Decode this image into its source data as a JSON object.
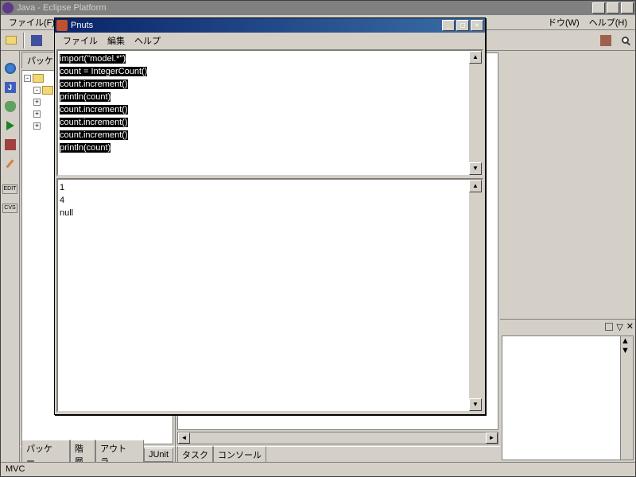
{
  "eclipse": {
    "title": "Java - Eclipse Platform",
    "menus": {
      "file": "ファイル(F)",
      "window_partial": "ドウ(W)",
      "help": "ヘルプ(H)"
    },
    "left_tab": "パッケ",
    "bottom_tabs": {
      "package": "パッケー...",
      "hierarchy": "階層",
      "outline": "アウトラ...",
      "junit": "JUnit",
      "tasks": "タスク",
      "console": "コンソール"
    },
    "status": "MVC"
  },
  "pnuts": {
    "title": "Pnuts",
    "menus": {
      "file": "ファイル",
      "edit": "編集",
      "help": "ヘルプ"
    },
    "code_lines": [
      "import(\"model.*\")",
      "",
      "count = IntegerCount()",
      "count.increment()",
      "println(count)",
      "count.increment()",
      "count.increment()",
      "count.increment()",
      "println(count)"
    ],
    "output_lines": [
      "1",
      "4",
      "null"
    ]
  },
  "win_controls": {
    "min": "_",
    "max": "□",
    "close": "✕"
  }
}
